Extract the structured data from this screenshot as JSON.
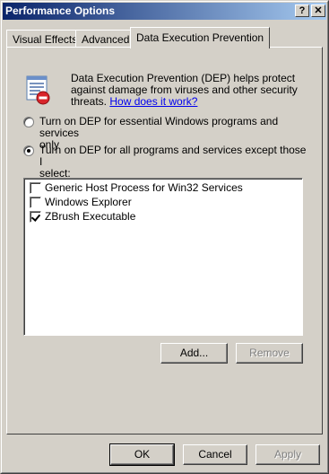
{
  "window": {
    "title": "Performance Options",
    "help_label": "?",
    "close_label": "✕"
  },
  "tabs": [
    {
      "label": "Visual Effects",
      "active": false
    },
    {
      "label": "Advanced",
      "active": false
    },
    {
      "label": "Data Execution Prevention",
      "active": true
    }
  ],
  "dep": {
    "desc_line1": "Data Execution Prevention (DEP) helps protect",
    "desc_line2": "against damage from viruses and other security",
    "desc_line3_pre": "threats. ",
    "desc_link": "How does it work?",
    "radio_essential_line1": "Turn on DEP for essential Windows programs and services",
    "radio_essential_line2": "only",
    "radio_essential_checked": false,
    "radio_all_line1": "Turn on DEP for all programs and services except those I",
    "radio_all_line2": "select:",
    "radio_all_checked": true
  },
  "list": {
    "items": [
      {
        "label": "Generic Host Process for Win32 Services",
        "checked": false
      },
      {
        "label": "Windows Explorer",
        "checked": false
      },
      {
        "label": "ZBrush Executable",
        "checked": true
      }
    ]
  },
  "buttons": {
    "add": "Add...",
    "remove": "Remove",
    "ok": "OK",
    "cancel": "Cancel",
    "apply": "Apply"
  }
}
